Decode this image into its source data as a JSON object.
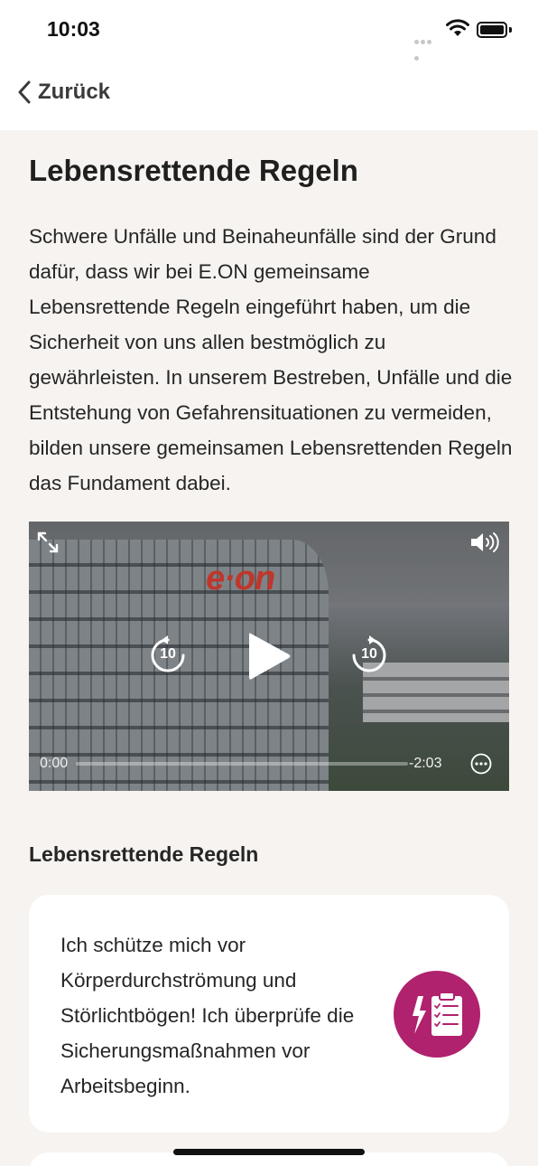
{
  "status_bar": {
    "time": "10:03"
  },
  "nav": {
    "back_label": "Zurück"
  },
  "page": {
    "title": "Lebensrettende Regeln",
    "intro": "Schwere Unfälle und Beinaheunfälle sind der Grund dafür, dass wir bei E.ON gemeinsame Lebensrettende Regeln eingeführt haben, um die Sicherheit von uns allen bestmöglich zu gewährleisten. In unserem Bestreben, Unfälle und die Entstehung von Gefahrensituationen zu vermeiden, bilden unsere gemeinsamen Lebensrettenden Regeln das Fundament dabei."
  },
  "video": {
    "brand_logo": "e·on",
    "elapsed": "0:00",
    "remaining": "-2:03",
    "skip_back_seconds": "10",
    "skip_forward_seconds": "10",
    "progress_fraction": 0.0
  },
  "rules_section": {
    "title": "Lebensrettende Regeln",
    "cards": [
      {
        "text": "Ich schütze mich vor Körperdurchströmung und Störlichtbögen! Ich überprüfe die Sicherungsmaßnahmen vor Arbeitsbeginn.",
        "icon": "electric-clipboard-icon",
        "icon_color": "#b0226d"
      }
    ]
  }
}
